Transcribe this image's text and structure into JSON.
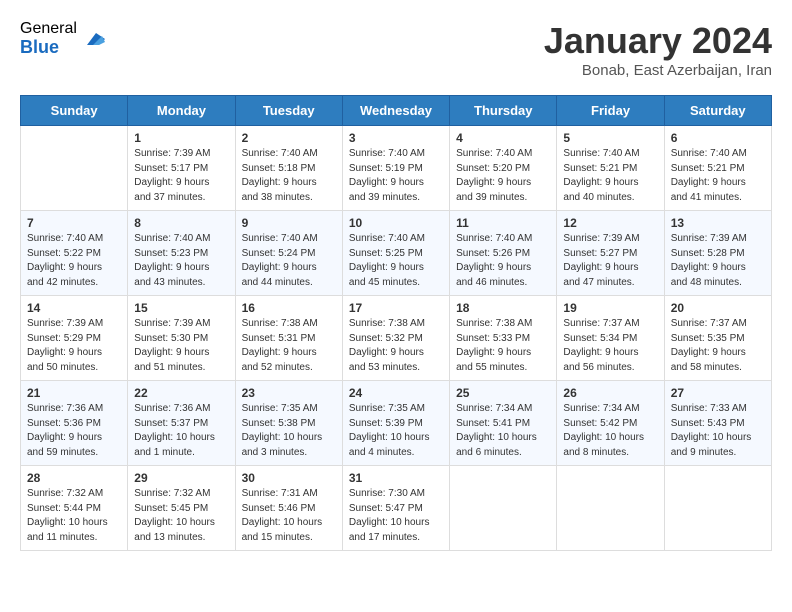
{
  "logo": {
    "general": "General",
    "blue": "Blue"
  },
  "title": "January 2024",
  "location": "Bonab, East Azerbaijan, Iran",
  "days_header": [
    "Sunday",
    "Monday",
    "Tuesday",
    "Wednesday",
    "Thursday",
    "Friday",
    "Saturday"
  ],
  "weeks": [
    [
      {
        "day": "",
        "sunrise": "",
        "sunset": "",
        "daylight": ""
      },
      {
        "day": "1",
        "sunrise": "Sunrise: 7:39 AM",
        "sunset": "Sunset: 5:17 PM",
        "daylight": "Daylight: 9 hours and 37 minutes."
      },
      {
        "day": "2",
        "sunrise": "Sunrise: 7:40 AM",
        "sunset": "Sunset: 5:18 PM",
        "daylight": "Daylight: 9 hours and 38 minutes."
      },
      {
        "day": "3",
        "sunrise": "Sunrise: 7:40 AM",
        "sunset": "Sunset: 5:19 PM",
        "daylight": "Daylight: 9 hours and 39 minutes."
      },
      {
        "day": "4",
        "sunrise": "Sunrise: 7:40 AM",
        "sunset": "Sunset: 5:20 PM",
        "daylight": "Daylight: 9 hours and 39 minutes."
      },
      {
        "day": "5",
        "sunrise": "Sunrise: 7:40 AM",
        "sunset": "Sunset: 5:21 PM",
        "daylight": "Daylight: 9 hours and 40 minutes."
      },
      {
        "day": "6",
        "sunrise": "Sunrise: 7:40 AM",
        "sunset": "Sunset: 5:21 PM",
        "daylight": "Daylight: 9 hours and 41 minutes."
      }
    ],
    [
      {
        "day": "7",
        "sunrise": "Sunrise: 7:40 AM",
        "sunset": "Sunset: 5:22 PM",
        "daylight": "Daylight: 9 hours and 42 minutes."
      },
      {
        "day": "8",
        "sunrise": "Sunrise: 7:40 AM",
        "sunset": "Sunset: 5:23 PM",
        "daylight": "Daylight: 9 hours and 43 minutes."
      },
      {
        "day": "9",
        "sunrise": "Sunrise: 7:40 AM",
        "sunset": "Sunset: 5:24 PM",
        "daylight": "Daylight: 9 hours and 44 minutes."
      },
      {
        "day": "10",
        "sunrise": "Sunrise: 7:40 AM",
        "sunset": "Sunset: 5:25 PM",
        "daylight": "Daylight: 9 hours and 45 minutes."
      },
      {
        "day": "11",
        "sunrise": "Sunrise: 7:40 AM",
        "sunset": "Sunset: 5:26 PM",
        "daylight": "Daylight: 9 hours and 46 minutes."
      },
      {
        "day": "12",
        "sunrise": "Sunrise: 7:39 AM",
        "sunset": "Sunset: 5:27 PM",
        "daylight": "Daylight: 9 hours and 47 minutes."
      },
      {
        "day": "13",
        "sunrise": "Sunrise: 7:39 AM",
        "sunset": "Sunset: 5:28 PM",
        "daylight": "Daylight: 9 hours and 48 minutes."
      }
    ],
    [
      {
        "day": "14",
        "sunrise": "Sunrise: 7:39 AM",
        "sunset": "Sunset: 5:29 PM",
        "daylight": "Daylight: 9 hours and 50 minutes."
      },
      {
        "day": "15",
        "sunrise": "Sunrise: 7:39 AM",
        "sunset": "Sunset: 5:30 PM",
        "daylight": "Daylight: 9 hours and 51 minutes."
      },
      {
        "day": "16",
        "sunrise": "Sunrise: 7:38 AM",
        "sunset": "Sunset: 5:31 PM",
        "daylight": "Daylight: 9 hours and 52 minutes."
      },
      {
        "day": "17",
        "sunrise": "Sunrise: 7:38 AM",
        "sunset": "Sunset: 5:32 PM",
        "daylight": "Daylight: 9 hours and 53 minutes."
      },
      {
        "day": "18",
        "sunrise": "Sunrise: 7:38 AM",
        "sunset": "Sunset: 5:33 PM",
        "daylight": "Daylight: 9 hours and 55 minutes."
      },
      {
        "day": "19",
        "sunrise": "Sunrise: 7:37 AM",
        "sunset": "Sunset: 5:34 PM",
        "daylight": "Daylight: 9 hours and 56 minutes."
      },
      {
        "day": "20",
        "sunrise": "Sunrise: 7:37 AM",
        "sunset": "Sunset: 5:35 PM",
        "daylight": "Daylight: 9 hours and 58 minutes."
      }
    ],
    [
      {
        "day": "21",
        "sunrise": "Sunrise: 7:36 AM",
        "sunset": "Sunset: 5:36 PM",
        "daylight": "Daylight: 9 hours and 59 minutes."
      },
      {
        "day": "22",
        "sunrise": "Sunrise: 7:36 AM",
        "sunset": "Sunset: 5:37 PM",
        "daylight": "Daylight: 10 hours and 1 minute."
      },
      {
        "day": "23",
        "sunrise": "Sunrise: 7:35 AM",
        "sunset": "Sunset: 5:38 PM",
        "daylight": "Daylight: 10 hours and 3 minutes."
      },
      {
        "day": "24",
        "sunrise": "Sunrise: 7:35 AM",
        "sunset": "Sunset: 5:39 PM",
        "daylight": "Daylight: 10 hours and 4 minutes."
      },
      {
        "day": "25",
        "sunrise": "Sunrise: 7:34 AM",
        "sunset": "Sunset: 5:41 PM",
        "daylight": "Daylight: 10 hours and 6 minutes."
      },
      {
        "day": "26",
        "sunrise": "Sunrise: 7:34 AM",
        "sunset": "Sunset: 5:42 PM",
        "daylight": "Daylight: 10 hours and 8 minutes."
      },
      {
        "day": "27",
        "sunrise": "Sunrise: 7:33 AM",
        "sunset": "Sunset: 5:43 PM",
        "daylight": "Daylight: 10 hours and 9 minutes."
      }
    ],
    [
      {
        "day": "28",
        "sunrise": "Sunrise: 7:32 AM",
        "sunset": "Sunset: 5:44 PM",
        "daylight": "Daylight: 10 hours and 11 minutes."
      },
      {
        "day": "29",
        "sunrise": "Sunrise: 7:32 AM",
        "sunset": "Sunset: 5:45 PM",
        "daylight": "Daylight: 10 hours and 13 minutes."
      },
      {
        "day": "30",
        "sunrise": "Sunrise: 7:31 AM",
        "sunset": "Sunset: 5:46 PM",
        "daylight": "Daylight: 10 hours and 15 minutes."
      },
      {
        "day": "31",
        "sunrise": "Sunrise: 7:30 AM",
        "sunset": "Sunset: 5:47 PM",
        "daylight": "Daylight: 10 hours and 17 minutes."
      },
      {
        "day": "",
        "sunrise": "",
        "sunset": "",
        "daylight": ""
      },
      {
        "day": "",
        "sunrise": "",
        "sunset": "",
        "daylight": ""
      },
      {
        "day": "",
        "sunrise": "",
        "sunset": "",
        "daylight": ""
      }
    ]
  ]
}
